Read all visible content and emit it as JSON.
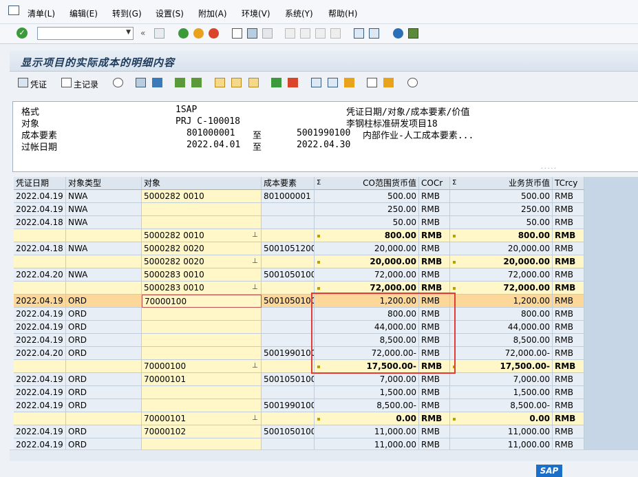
{
  "menu": [
    "清单(L)",
    "编辑(E)",
    "转到(G)",
    "设置(S)",
    "附加(A)",
    "环境(V)",
    "系统(Y)",
    "帮助(H)"
  ],
  "title": "显示项目的实际成本的明细内容",
  "app_toolbar": {
    "voucher": "凭证",
    "master_record": "主记录"
  },
  "header": {
    "l1": "格式",
    "v1": "1SAP",
    "r1": "凭证日期/对象/成本要素/价值",
    "l2": "对象",
    "v2": "PRJ C-100018",
    "r2": "李钢柱标准研发项目18",
    "l3": "成本要素",
    "v3a": "801000001",
    "to3": "至",
    "v3b": "5001990100",
    "r3": "内部作业-人工成本要素...",
    "l4": "过帐日期",
    "v4a": "2022.04.01",
    "to4": "至",
    "v4b": "2022.04.30"
  },
  "columns": [
    "凭证日期",
    "对象类型",
    "对象",
    "成本要素",
    "Σ",
    "CO范围货币值",
    "COCr",
    "Σ",
    "业务货币值",
    "TCrcy"
  ],
  "rows": [
    {
      "t": "n",
      "d": "2022.04.19",
      "ot": "NWA",
      "o": "5000282 0010",
      "ce": "801000001",
      "co": "500.00",
      "cc": "RMB",
      "bv": "500.00",
      "tc": "RMB"
    },
    {
      "t": "n",
      "d": "2022.04.19",
      "ot": "NWA",
      "o": "",
      "ce": "",
      "co": "250.00",
      "cc": "RMB",
      "bv": "250.00",
      "tc": "RMB"
    },
    {
      "t": "n",
      "d": "2022.04.18",
      "ot": "NWA",
      "o": "",
      "ce": "",
      "co": "50.00",
      "cc": "RMB",
      "bv": "50.00",
      "tc": "RMB"
    },
    {
      "t": "s",
      "d": "",
      "ot": "",
      "o": "5000282 0010",
      "ce": "",
      "co": "800.00",
      "cc": "RMB",
      "bv": "800.00",
      "tc": "RMB"
    },
    {
      "t": "n",
      "d": "2022.04.18",
      "ot": "NWA",
      "o": "5000282 0020",
      "ce": "5001051200",
      "co": "20,000.00",
      "cc": "RMB",
      "bv": "20,000.00",
      "tc": "RMB"
    },
    {
      "t": "s",
      "d": "",
      "ot": "",
      "o": "5000282 0020",
      "ce": "",
      "co": "20,000.00",
      "cc": "RMB",
      "bv": "20,000.00",
      "tc": "RMB"
    },
    {
      "t": "n",
      "d": "2022.04.20",
      "ot": "NWA",
      "o": "5000283 0010",
      "ce": "5001050100",
      "co": "72,000.00",
      "cc": "RMB",
      "bv": "72,000.00",
      "tc": "RMB"
    },
    {
      "t": "s",
      "d": "",
      "ot": "",
      "o": "5000283 0010",
      "ce": "",
      "co": "72,000.00",
      "cc": "RMB",
      "bv": "72,000.00",
      "tc": "RMB"
    },
    {
      "t": "h",
      "d": "2022.04.19",
      "ot": "ORD",
      "o": "70000100",
      "ce": "5001050100",
      "co": "1,200.00",
      "cc": "RMB",
      "bv": "1,200.00",
      "tc": "RMB"
    },
    {
      "t": "n",
      "d": "2022.04.19",
      "ot": "ORD",
      "o": "",
      "ce": "",
      "co": "800.00",
      "cc": "RMB",
      "bv": "800.00",
      "tc": "RMB"
    },
    {
      "t": "n",
      "d": "2022.04.19",
      "ot": "ORD",
      "o": "",
      "ce": "",
      "co": "44,000.00",
      "cc": "RMB",
      "bv": "44,000.00",
      "tc": "RMB"
    },
    {
      "t": "n",
      "d": "2022.04.19",
      "ot": "ORD",
      "o": "",
      "ce": "",
      "co": "8,500.00",
      "cc": "RMB",
      "bv": "8,500.00",
      "tc": "RMB"
    },
    {
      "t": "n",
      "d": "2022.04.20",
      "ot": "ORD",
      "o": "",
      "ce": "5001990100",
      "co": "72,000.00-",
      "cc": "RMB",
      "bv": "72,000.00-",
      "tc": "RMB"
    },
    {
      "t": "s",
      "d": "",
      "ot": "",
      "o": "70000100",
      "ce": "",
      "co": "17,500.00-",
      "cc": "RMB",
      "bv": "17,500.00-",
      "tc": "RMB"
    },
    {
      "t": "n",
      "d": "2022.04.19",
      "ot": "ORD",
      "o": "70000101",
      "ce": "5001050100",
      "co": "7,000.00",
      "cc": "RMB",
      "bv": "7,000.00",
      "tc": "RMB"
    },
    {
      "t": "n",
      "d": "2022.04.19",
      "ot": "ORD",
      "o": "",
      "ce": "",
      "co": "1,500.00",
      "cc": "RMB",
      "bv": "1,500.00",
      "tc": "RMB"
    },
    {
      "t": "n",
      "d": "2022.04.19",
      "ot": "ORD",
      "o": "",
      "ce": "5001990100",
      "co": "8,500.00-",
      "cc": "RMB",
      "bv": "8,500.00-",
      "tc": "RMB"
    },
    {
      "t": "s",
      "d": "",
      "ot": "",
      "o": "70000101",
      "ce": "",
      "co": "0.00",
      "cc": "RMB",
      "bv": "0.00",
      "tc": "RMB"
    },
    {
      "t": "n",
      "d": "2022.04.19",
      "ot": "ORD",
      "o": "70000102",
      "ce": "5001050100",
      "co": "11,000.00",
      "cc": "RMB",
      "bv": "11,000.00",
      "tc": "RMB"
    },
    {
      "t": "n",
      "d": "2022.04.19",
      "ot": "ORD",
      "o": "",
      "ce": "",
      "co": "11,000.00",
      "cc": "RMB",
      "bv": "11,000.00",
      "tc": "RMB"
    }
  ],
  "logo": "SAP"
}
